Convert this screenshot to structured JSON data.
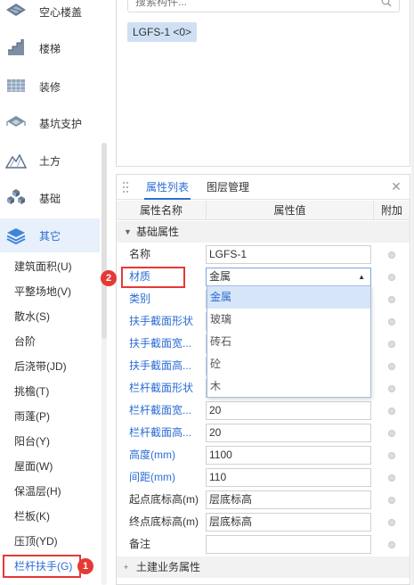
{
  "left_panel": {
    "categories": [
      {
        "label": "空心楼盖",
        "icon": "hollow-floor-icon"
      },
      {
        "label": "楼梯",
        "icon": "stairs-icon"
      },
      {
        "label": "装修",
        "icon": "decoration-icon"
      },
      {
        "label": "基坑支护",
        "icon": "foundation-pit-icon"
      },
      {
        "label": "土方",
        "icon": "earthwork-icon"
      },
      {
        "label": "基础",
        "icon": "foundation-icon"
      },
      {
        "label": "其它",
        "icon": "layers-icon",
        "active": true
      }
    ],
    "sub_items": [
      "建筑面积(U)",
      "平整场地(V)",
      "散水(S)",
      "台阶",
      "后浇带(JD)",
      "挑檐(T)",
      "雨蓬(P)",
      "阳台(Y)",
      "屋面(W)",
      "保温层(H)",
      "栏板(K)",
      "压顶(YD)",
      "栏杆扶手(G)"
    ]
  },
  "upper_panel": {
    "search_placeholder": "搜索构件...",
    "component_tag": "LGFS-1 <0>"
  },
  "property_panel": {
    "tabs": [
      "属性列表",
      "图层管理"
    ],
    "active_tab": "属性列表",
    "columns": [
      "属性名称",
      "属性值",
      "附加"
    ],
    "group_basic": "基础属性",
    "group_civil": "土建业务属性",
    "rows": [
      {
        "name": "名称",
        "value": "LGFS-1",
        "color": "dark"
      },
      {
        "name": "材质",
        "value": "金属",
        "color": "blue"
      },
      {
        "name": "类别",
        "value": "",
        "color": "blue"
      },
      {
        "name": "扶手截面形状",
        "value": "",
        "color": "blue"
      },
      {
        "name": "扶手截面宽...",
        "value": "",
        "color": "blue"
      },
      {
        "name": "扶手截面高...",
        "value": "",
        "color": "blue"
      },
      {
        "name": "栏杆截面形状",
        "value": "",
        "color": "blue"
      },
      {
        "name": "栏杆截面宽...",
        "value": "20",
        "color": "blue"
      },
      {
        "name": "栏杆截面高...",
        "value": "20",
        "color": "blue"
      },
      {
        "name": "高度(mm)",
        "value": "1100",
        "color": "blue"
      },
      {
        "name": "间距(mm)",
        "value": "110",
        "color": "blue"
      },
      {
        "name": "起点底标高(m)",
        "value": "层底标高",
        "color": "dark"
      },
      {
        "name": "终点底标高(m)",
        "value": "层底标高",
        "color": "dark"
      },
      {
        "name": "备注",
        "value": "",
        "color": "dark"
      }
    ],
    "material_options": [
      "金属",
      "玻璃",
      "砖石",
      "砼",
      "木"
    ],
    "selected_option": "金属"
  },
  "annotations": {
    "badge_1": "1",
    "badge_2": "2",
    "color": "#e53935"
  },
  "colors": {
    "accent": "#2b6cd4",
    "active_bg": "#e8f0fb",
    "tag_bg": "#cfe0f5"
  }
}
